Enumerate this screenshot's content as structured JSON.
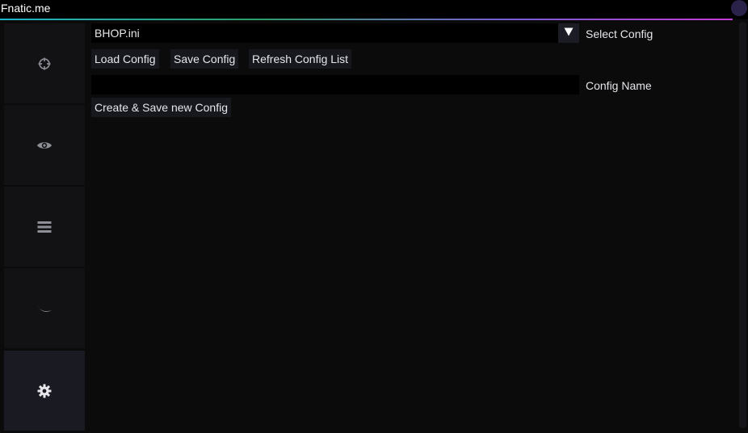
{
  "window": {
    "title": "Fnatic.me",
    "accent_gradient": [
      "#1fb4c8",
      "#2e9e6a",
      "#7a5cd6",
      "#c23ad1"
    ],
    "close_dot_color": "#2a2248"
  },
  "sidebar": {
    "tabs": [
      {
        "icon": "crosshair-icon",
        "active": false
      },
      {
        "icon": "eye-icon",
        "active": false
      },
      {
        "icon": "menu-lines-icon",
        "active": false
      },
      {
        "icon": "crescent-icon",
        "active": false
      },
      {
        "icon": "gear-icon",
        "active": true
      }
    ]
  },
  "config": {
    "select_value": "BHOP.ini",
    "select_label": "Select Config",
    "load_label": "Load Config",
    "save_label": "Save Config",
    "refresh_label": "Refresh Config List",
    "name_value": "",
    "name_label": "Config Name",
    "create_label": "Create & Save new Config"
  }
}
